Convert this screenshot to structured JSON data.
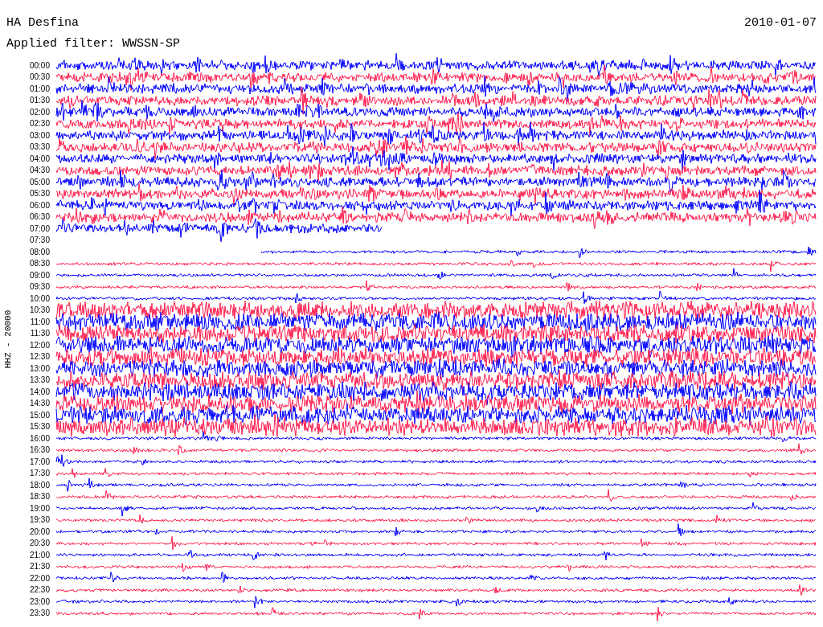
{
  "header": {
    "station": "HA Desfina",
    "date": "2010-01-07",
    "filter": "Applied filter: WWSSN-SP"
  },
  "axis_label": "HHZ - 20000",
  "traces": [
    {
      "time": "00:00",
      "color": "#0000ff"
    },
    {
      "time": "00:30",
      "color": "#ff1f4f"
    },
    {
      "time": "01:00",
      "color": "#0000ff"
    },
    {
      "time": "01:30",
      "color": "#ff1f4f"
    },
    {
      "time": "02:00",
      "color": "#0000ff"
    },
    {
      "time": "02:30",
      "color": "#ff1f4f"
    },
    {
      "time": "03:00",
      "color": "#0000ff"
    },
    {
      "time": "03:30",
      "color": "#ff1f4f"
    },
    {
      "time": "04:00",
      "color": "#0000ff"
    },
    {
      "time": "04:30",
      "color": "#ff1f4f"
    },
    {
      "time": "05:00",
      "color": "#0000ff"
    },
    {
      "time": "05:30",
      "color": "#ff1f4f"
    },
    {
      "time": "06:00",
      "color": "#0000ff"
    },
    {
      "time": "06:30",
      "color": "#ff1f4f"
    },
    {
      "time": "07:00",
      "color": "#0000ff"
    },
    {
      "time": "07:30"
    },
    {
      "time": "08:00",
      "color": "#0000ff"
    },
    {
      "time": "08:30",
      "color": "#ff1f4f"
    },
    {
      "time": "09:00",
      "color": "#0000ff"
    },
    {
      "time": "09:30",
      "color": "#ff1f4f"
    },
    {
      "time": "10:00",
      "color": "#0000ff"
    },
    {
      "time": "10:30",
      "color": "#ff1f4f"
    },
    {
      "time": "11:00",
      "color": "#0000ff"
    },
    {
      "time": "11:30",
      "color": "#ff1f4f"
    },
    {
      "time": "12:00",
      "color": "#0000ff"
    },
    {
      "time": "12:30",
      "color": "#ff1f4f"
    },
    {
      "time": "13:00",
      "color": "#0000ff"
    },
    {
      "time": "13:30",
      "color": "#ff1f4f"
    },
    {
      "time": "14:00",
      "color": "#0000ff"
    },
    {
      "time": "14:30",
      "color": "#ff1f4f"
    },
    {
      "time": "15:00",
      "color": "#0000ff"
    },
    {
      "time": "15:30",
      "color": "#ff1f4f"
    },
    {
      "time": "16:00",
      "color": "#0000ff"
    },
    {
      "time": "16:30",
      "color": "#ff1f4f"
    },
    {
      "time": "17:00",
      "color": "#0000ff"
    },
    {
      "time": "17:30",
      "color": "#ff1f4f"
    },
    {
      "time": "18:00",
      "color": "#0000ff"
    },
    {
      "time": "18:30",
      "color": "#ff1f4f"
    },
    {
      "time": "19:00",
      "color": "#0000ff"
    },
    {
      "time": "19:30",
      "color": "#ff1f4f"
    },
    {
      "time": "20:00",
      "color": "#0000ff"
    },
    {
      "time": "20:30",
      "color": "#ff1f4f"
    },
    {
      "time": "21:00",
      "color": "#0000ff"
    },
    {
      "time": "21:30",
      "color": "#ff1f4f"
    },
    {
      "time": "22:00",
      "color": "#0000ff"
    },
    {
      "time": "22:30",
      "color": "#ff1f4f"
    },
    {
      "time": "23:00",
      "color": "#0000ff"
    },
    {
      "time": "23:30",
      "color": "#ff1f4f"
    }
  ]
}
